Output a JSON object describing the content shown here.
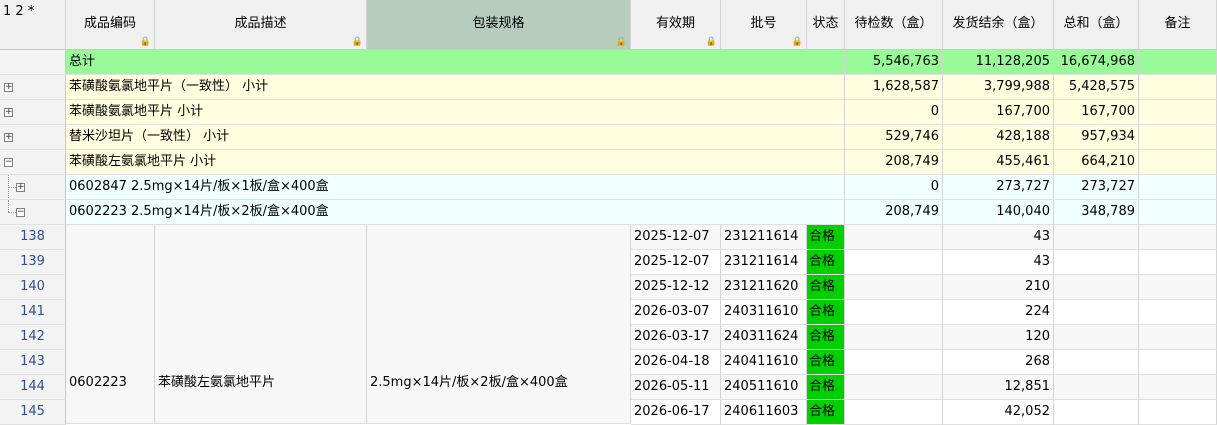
{
  "outline_levels": "1 2",
  "header_corner": "*",
  "columns": {
    "code": "成品编码",
    "desc": "成品描述",
    "pack": "包装规格",
    "expiry": "有效期",
    "batch": "批号",
    "status": "状态",
    "pending": "待检数（盒）",
    "balance": "发货结余（盒）",
    "sum": "总和（盒）",
    "remark": "备注"
  },
  "total": {
    "label": "总计",
    "pending": "5,546,763",
    "balance": "11,128,205",
    "sum": "16,674,968"
  },
  "subtotals": [
    {
      "label": "苯磺酸氨氯地平片（一致性） 小计",
      "pending": "1,628,587",
      "balance": "3,799,988",
      "sum": "5,428,575"
    },
    {
      "label": "苯磺酸氨氯地平片 小计",
      "pending": "0",
      "balance": "167,700",
      "sum": "167,700"
    },
    {
      "label": "替米沙坦片（一致性） 小计",
      "pending": "529,746",
      "balance": "428,188",
      "sum": "957,934"
    },
    {
      "label": "苯磺酸左氨氯地平片 小计",
      "pending": "208,749",
      "balance": "455,461",
      "sum": "664,210"
    }
  ],
  "details": [
    {
      "label": "0602847    2.5mg×14片/板×1板/盒×400盒",
      "pending": "0",
      "balance": "273,727",
      "sum": "273,727"
    },
    {
      "label": "0602223    2.5mg×14片/板×2板/盒×400盒",
      "pending": "208,749",
      "balance": "140,040",
      "sum": "348,789"
    }
  ],
  "merged": {
    "code": "0602223",
    "desc": "苯磺酸左氨氯地平片",
    "pack": "2.5mg×14片/板×2板/盒×400盒"
  },
  "rows": [
    {
      "num": "138",
      "expiry": "2025-12-07",
      "batch": "231211614",
      "status": "合格",
      "balance": "43"
    },
    {
      "num": "139",
      "expiry": "2025-12-07",
      "batch": "231211614",
      "status": "合格",
      "balance": "43"
    },
    {
      "num": "140",
      "expiry": "2025-12-12",
      "batch": "231211620",
      "status": "合格",
      "balance": "210"
    },
    {
      "num": "141",
      "expiry": "2026-03-07",
      "batch": "240311610",
      "status": "合格",
      "balance": "224"
    },
    {
      "num": "142",
      "expiry": "2026-03-17",
      "batch": "240311624",
      "status": "合格",
      "balance": "120"
    },
    {
      "num": "143",
      "expiry": "2026-04-18",
      "batch": "240411610",
      "status": "合格",
      "balance": "268"
    },
    {
      "num": "144",
      "expiry": "2026-05-11",
      "batch": "240511610",
      "status": "合格",
      "balance": "12,851"
    },
    {
      "num": "145",
      "expiry": "2026-06-17",
      "batch": "240611603",
      "status": "合格",
      "balance": "42,052"
    }
  ]
}
